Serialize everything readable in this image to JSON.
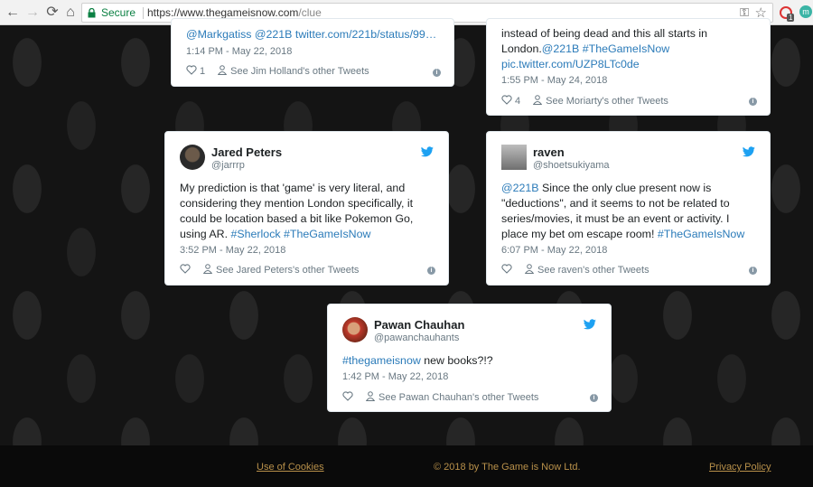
{
  "browser": {
    "secure_label": "Secure",
    "url_host": "https://www.thegameisnow.com",
    "url_path": "/clue",
    "extension_badge": "1",
    "profile_initial": "m"
  },
  "tweets": [
    {
      "text_link": "@Markgatiss @221B twitter.com/221b/status/99…",
      "time": "1:14 PM - May 22, 2018",
      "likes": "1",
      "see_other": "See Jim Holland's other Tweets"
    },
    {
      "text_line1": "instead of being dead and this all starts in",
      "text_line2_plain": "London.",
      "text_line2_link": "@221B #TheGameIsNow",
      "text_line3_link": "pic.twitter.com/UZP8LTc0de",
      "time": "1:55 PM - May 24, 2018",
      "likes": "4",
      "see_other": "See Moriarty's other Tweets"
    },
    {
      "name": "Jared Peters",
      "handle": "@jarrrp",
      "line1": "My prediction is that 'game' is very literal, and",
      "line2": "considering they mention London specifically, it",
      "line3": "could be location based a bit like Pokemon Go,",
      "line4_plain": "using AR. ",
      "line4_link": "#Sherlock #TheGameIsNow",
      "time": "3:52 PM - May 22, 2018",
      "see_other": "See Jared Peters's other Tweets"
    },
    {
      "name": "raven",
      "handle": "@shoetsukiyama",
      "line1_link": "@221B",
      "line1_plain": " Since the only clue present now is",
      "line2": "\"deductions\", and it seems to not be related to",
      "line3": "series/movies, it must be an event or activity. I",
      "line4_plain": "place my bet om escape room! ",
      "line4_link": "#TheGameIsNow",
      "time": "6:07 PM - May 22, 2018",
      "see_other": "See raven's other Tweets"
    },
    {
      "name": "Pawan Chauhan",
      "handle": "@pawanchauhants",
      "line1_link": "#thegameisnow",
      "line1_plain": " new books?!?",
      "time": "1:42 PM - May 22, 2018",
      "see_other": "See Pawan Chauhan's other Tweets"
    }
  ],
  "footer": {
    "cookies": "Use of Cookies",
    "copyright": "© 2018 by The Game is Now Ltd.",
    "privacy": "Privacy Policy"
  },
  "colors": {
    "link": "#2b7bb9",
    "footer_text": "#b8904a",
    "twitter_blue": "#1da1f2"
  }
}
